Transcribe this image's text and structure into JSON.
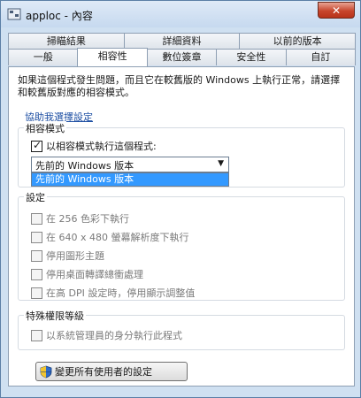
{
  "window": {
    "title": "apploc - 內容",
    "close_label": "✕"
  },
  "tabs": {
    "back_row": [
      "掃瞄結果",
      "詳細資料",
      "以前的版本"
    ],
    "front_row": [
      "一般",
      "相容性",
      "數位簽章",
      "安全性",
      "自訂"
    ],
    "active": "相容性"
  },
  "intro_text": "如果這個程式發生問題，而且它在較舊版的 Windows 上執行正常，請選擇和較舊版對應的相容模式。",
  "help_link": "協助我選擇設定",
  "compat_mode": {
    "label": "相容模式",
    "checkbox_label": "以相容模式執行這個程式:",
    "checked": true,
    "selected_value": "先前的 Windows 版本",
    "dropdown_option": "先前的 Windows 版本"
  },
  "settings": {
    "label": "設定",
    "options": [
      "在 256 色彩下執行",
      "在 640 x 480 螢幕解析度下執行",
      "停用圖形主題",
      "停用桌面轉譯總衝處理",
      "在高 DPI 設定時，停用顯示調整值"
    ]
  },
  "privilege": {
    "label": "特殊權限等級",
    "option": "以系統管理員的身分執行此程式"
  },
  "change_all_button": "變更所有使用者的設定",
  "icons": {
    "app": "app-icon",
    "shield": "uac-shield-icon",
    "dropdown": "chevron-down-icon"
  }
}
